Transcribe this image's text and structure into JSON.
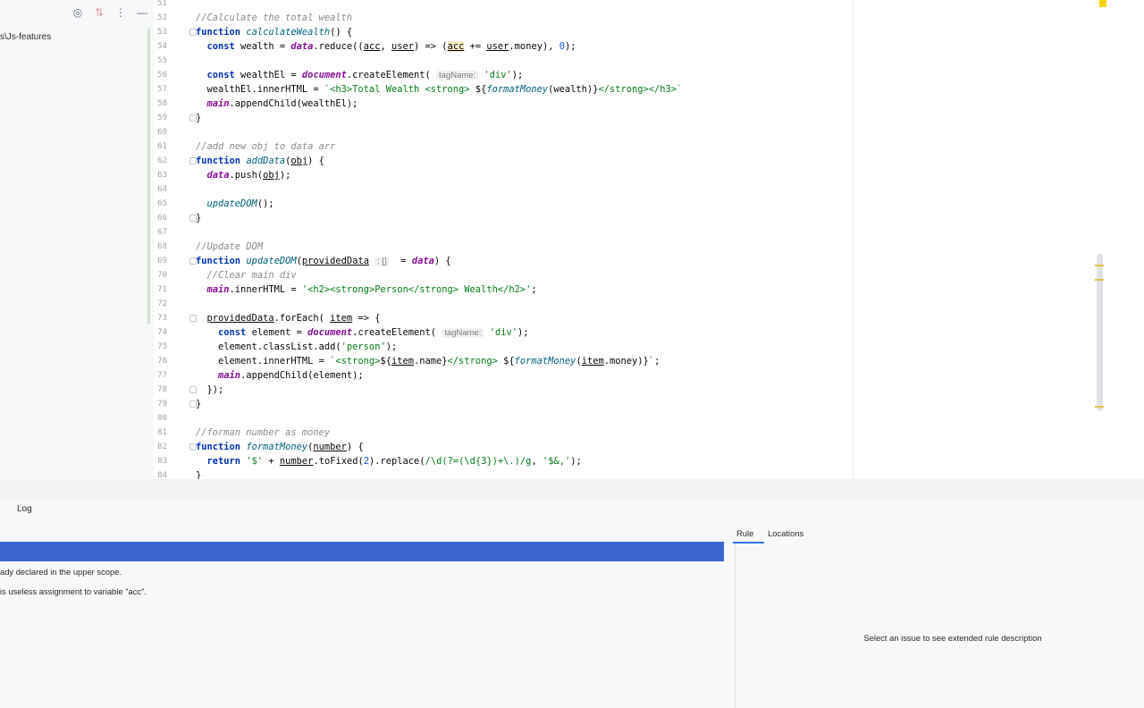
{
  "project_tree": {
    "path_label": "s\\Js-features",
    "toolbar_icons": [
      "target-icon",
      "collapse-icon",
      "more-vertical-icon",
      "minimize-icon"
    ]
  },
  "editor": {
    "lines": [
      {
        "n": "51",
        "html": ""
      },
      {
        "n": "52",
        "html": "<span class='cm'>//Calculate the total wealth</span>"
      },
      {
        "n": "53",
        "fold": true,
        "html": "<span class='kw'>function</span> <span class='fn'>calculateWealth</span>() {"
      },
      {
        "n": "54",
        "html": "  <span class='kw'>const</span> wealth = <span class='glob'>data</span>.reduce((<u>acc</u>, <u>user</u>) => (<u style='background:#f5eac4'>acc</u> += <u>user</u>.money), <span class='num'>0</span>);"
      },
      {
        "n": "55",
        "html": ""
      },
      {
        "n": "56",
        "html": "  <span class='kw'>const</span> wealthEl = <span class='glob'>document</span>.createElement( <span class='hint'>tagName:</span> <span class='str'>'div'</span>);"
      },
      {
        "n": "57",
        "html": "  wealthEl.innerHTML = <span class='str'>`&lt;h3&gt;Total Wealth &lt;strong&gt; </span>${<span class='fn'>formatMoney</span>(wealth)}<span class='str'>&lt;/strong&gt;&lt;/h3&gt;`</span>"
      },
      {
        "n": "58",
        "html": "  <span class='glob'>main</span>.appendChild(wealthEl);"
      },
      {
        "n": "59",
        "fold": true,
        "html": "}"
      },
      {
        "n": "60",
        "html": ""
      },
      {
        "n": "61",
        "html": "<span class='cm'>//add new obj to data arr</span>"
      },
      {
        "n": "62",
        "fold": true,
        "html": "<span class='kw'>function</span> <span class='fn'>addData</span>(<u>obj</u>) {"
      },
      {
        "n": "63",
        "html": "  <span class='glob'>data</span>.push(<u>obj</u>);"
      },
      {
        "n": "64",
        "html": ""
      },
      {
        "n": "65",
        "html": "  <span class='fn'>updateDOM</span>();"
      },
      {
        "n": "66",
        "fold": true,
        "html": "}"
      },
      {
        "n": "67",
        "html": ""
      },
      {
        "n": "68",
        "html": "<span class='cm'>//Update DOM</span>"
      },
      {
        "n": "69",
        "fold": true,
        "html": "<span class='kw'>function</span> <span class='fn'>updateDOM</span>(<u>providedData</u> <span class='hint'>: []</span>  = <span class='glob'>data</span>) {"
      },
      {
        "n": "70",
        "html": "  <span class='cm'>//Clear main div</span>"
      },
      {
        "n": "71",
        "html": "  <span class='glob'>main</span>.innerHTML = <span class='str'>'&lt;h2&gt;&lt;strong&gt;Person&lt;/strong&gt; Wealth&lt;/h2&gt;'</span>;"
      },
      {
        "n": "72",
        "html": ""
      },
      {
        "n": "73",
        "fold": true,
        "html": "  <u>providedData</u>.forEach( <u>item</u> => {"
      },
      {
        "n": "74",
        "html": "    <span class='kw'>const</span> element = <span class='glob'>document</span>.createElement( <span class='hint'>tagName:</span> <span class='str'>'div'</span>);"
      },
      {
        "n": "75",
        "html": "    element.classList.add(<span class='str'>'person'</span>);"
      },
      {
        "n": "76",
        "html": "    element.innerHTML = <span class='str'>`&lt;strong&gt;</span>${<u>item</u>.name}<span class='str'>&lt;/strong&gt; </span>${<span class='fn'>formatMoney</span>(<u>item</u>.money)}<span class='str'>`</span>;"
      },
      {
        "n": "77",
        "html": "    <span class='glob'>main</span>.appendChild(element);"
      },
      {
        "n": "78",
        "fold": true,
        "html": "  });"
      },
      {
        "n": "79",
        "fold": true,
        "html": "}"
      },
      {
        "n": "80",
        "html": ""
      },
      {
        "n": "81",
        "html": "<span class='cm'>//forman number as money</span>"
      },
      {
        "n": "82",
        "fold": true,
        "html": "<span class='kw'>function</span> <span class='fn'>formatMoney</span>(<u>number</u>) {"
      },
      {
        "n": "83",
        "html": "  <span class='kw'>return</span> <span class='str'>'$'</span> + <u>number</u>.toFixed(<span class='num'>2</span>).replace(<span class='str'>/\\d(?=(\\d{3})+\\.)/g</span>, <span class='str'>'$&amp;,'</span>);"
      },
      {
        "n": "84",
        "html": "}"
      }
    ]
  },
  "bottom_tabs": {
    "partial": "",
    "log": "Log"
  },
  "problems": {
    "items": [
      "ady declared in the upper scope.",
      "is useless assignment to variable \"acc\"."
    ]
  },
  "rule_panel": {
    "tab_rule": "Rule",
    "tab_locations": "Locations",
    "empty_message": "Select an issue to see extended rule description"
  },
  "colors": {
    "selection": "#3b66d1",
    "accent": "#3574f0",
    "warning_marker": "#ffd500"
  }
}
